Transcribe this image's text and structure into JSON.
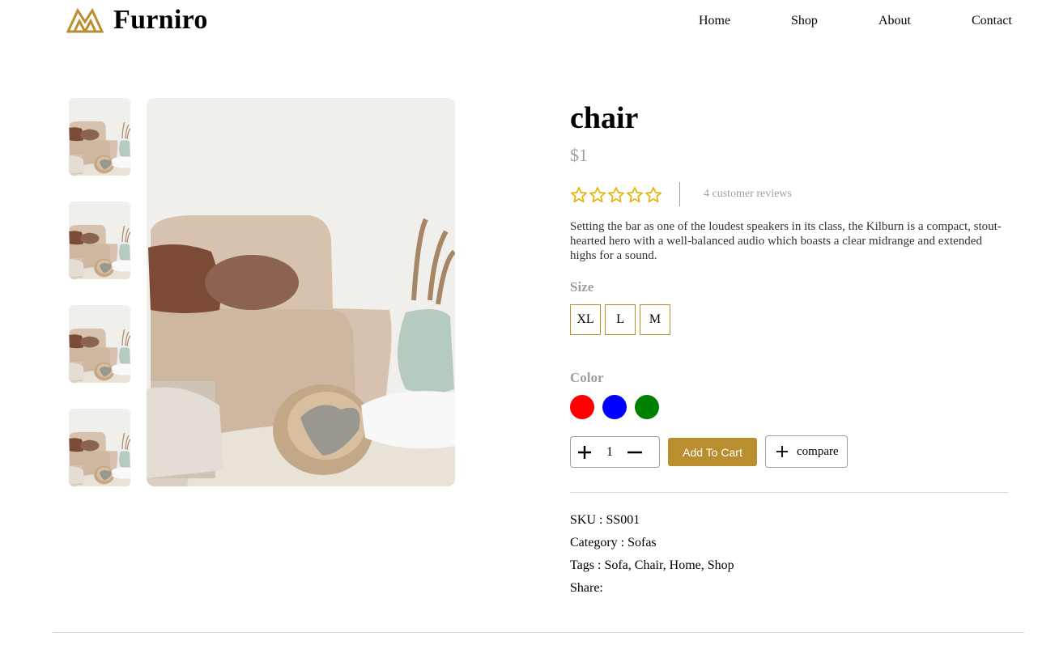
{
  "brand": {
    "name": "Furniro",
    "color": "#b88e2f",
    "logo_icon": "furniro-logo-icon"
  },
  "nav": {
    "home": "Home",
    "shop": "Shop",
    "about": "About",
    "contact": "Contact"
  },
  "gallery": {
    "thumbnail_count": 4,
    "main_image": "sofa-living-room-image"
  },
  "product": {
    "title": "chair",
    "price": "$1",
    "rating": {
      "stars_filled": 0,
      "stars_total": 5,
      "star_color": "#e8b100"
    },
    "reviews": "4 customer reviews",
    "description": "Setting the bar as one of the loudest speakers in its class, the Kilburn is a compact, stout-hearted hero with a well-balanced audio which boasts a clear midrange and extended highs for a sound.",
    "size_label": "Size",
    "sizes": [
      "XL",
      "L",
      "M"
    ],
    "color_label": "Color",
    "colors": [
      "#ff0000",
      "#0000ff",
      "#008000"
    ],
    "quantity": "1",
    "add_to_cart": "Add To Cart",
    "compare": "compare"
  },
  "meta": {
    "sku_label": "SKU :",
    "sku": "SS001",
    "category_label": "Category :",
    "category": "Sofas",
    "tags_label": "Tags :",
    "tags": "Sofa, Chair, Home, Shop",
    "share_label": "Share:"
  }
}
